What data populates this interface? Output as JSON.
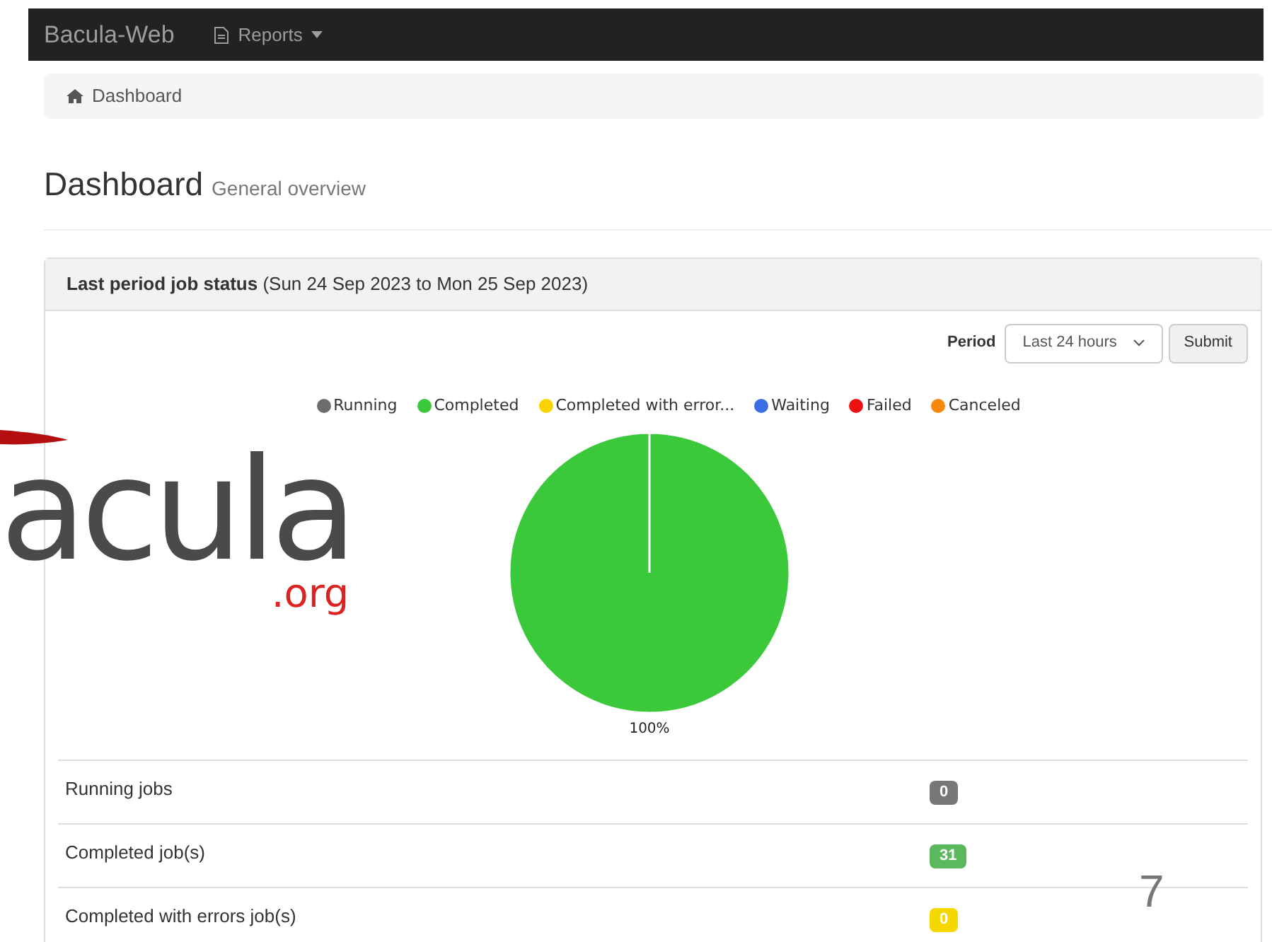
{
  "navbar": {
    "brand": "Bacula-Web",
    "menu": [
      {
        "label": "Reports"
      }
    ]
  },
  "breadcrumb": [
    "Dashboard"
  ],
  "page_header": {
    "title": "Dashboard",
    "subtitle": "General overview"
  },
  "panel": {
    "title_bold": "Last period job status",
    "title_rest": "(Sun 24 Sep 2023 to Mon 25 Sep 2023)",
    "period_label": "Period",
    "period_value": "Last 24 hours",
    "submit": "Submit",
    "chart_data": {
      "type": "pie",
      "categories": [
        "Running",
        "Completed",
        "Completed with error...",
        "Waiting",
        "Failed",
        "Canceled"
      ],
      "series": [
        {
          "values": [
            0,
            100,
            0,
            0,
            0,
            0
          ]
        }
      ],
      "colors": [
        "#6d6d6d",
        "#3bc93b",
        "#fad200",
        "#3d6ee6",
        "#ee1111",
        "#f8870c"
      ],
      "value_labels": [
        null,
        "100%",
        null,
        null,
        null,
        null
      ]
    },
    "rows": [
      {
        "label": "Running jobs",
        "count": "0",
        "color": "#777777"
      },
      {
        "label": "Completed job(s)",
        "count": "31",
        "color": "#5cb85c"
      },
      {
        "label": "Completed with errors job(s)",
        "count": "0",
        "color": "#f5d800"
      }
    ]
  },
  "slide": {
    "logo_text": "acula",
    "logo_suffix": ".org",
    "page_number": "7"
  }
}
